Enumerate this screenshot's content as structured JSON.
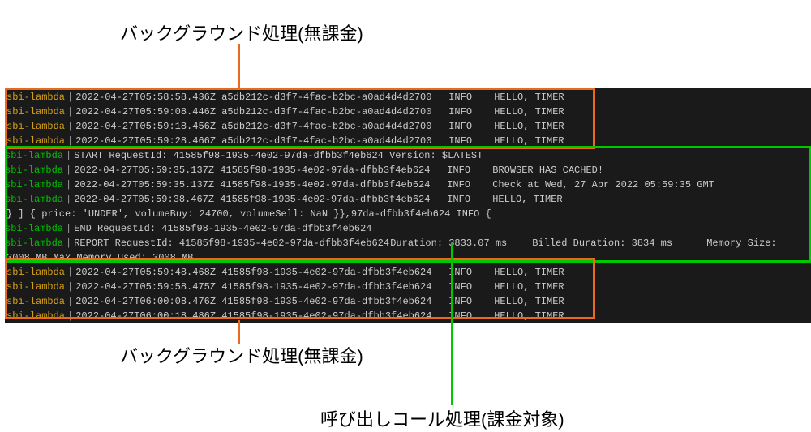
{
  "annotations": {
    "top": "バックグラウンド処理(無課金)",
    "bottom": "バックグラウンド処理(無課金)",
    "green": "呼び出しコール処理(課金対象)"
  },
  "source_label": "sbi-lambda",
  "pipe": "|",
  "bg_lines_top": [
    {
      "ts": "2022-04-27T05:58:58.436Z",
      "id": "a5db212c-d3f7-4fac-b2bc-a0ad4d4d2700",
      "level": "INFO",
      "msg": "HELLO, TIMER"
    },
    {
      "ts": "2022-04-27T05:59:08.446Z",
      "id": "a5db212c-d3f7-4fac-b2bc-a0ad4d4d2700",
      "level": "INFO",
      "msg": "HELLO, TIMER"
    },
    {
      "ts": "2022-04-27T05:59:18.456Z",
      "id": "a5db212c-d3f7-4fac-b2bc-a0ad4d4d2700",
      "level": "INFO",
      "msg": "HELLO, TIMER"
    },
    {
      "ts": "2022-04-27T05:59:28.466Z",
      "id": "a5db212c-d3f7-4fac-b2bc-a0ad4d4d2700",
      "level": "INFO",
      "msg": "HELLO, TIMER"
    }
  ],
  "billed_block": {
    "start": "START RequestId: 41585f98-1935-4e02-97da-dfbb3f4eb624 Version: $LATEST",
    "logs": [
      {
        "ts": "2022-04-27T05:59:35.137Z",
        "id": "41585f98-1935-4e02-97da-dfbb3f4eb624",
        "level": "INFO",
        "msg": "BROWSER HAS CACHED!"
      },
      {
        "ts": "2022-04-27T05:59:35.137Z",
        "id": "41585f98-1935-4e02-97da-dfbb3f4eb624",
        "level": "INFO",
        "msg": "Check at Wed, 27 Apr 2022 05:59:35 GMT"
      },
      {
        "ts": "2022-04-27T05:59:38.467Z",
        "id": "41585f98-1935-4e02-97da-dfbb3f4eb624",
        "level": "INFO",
        "msg": "HELLO, TIMER"
      }
    ],
    "payload_line": "} ] { price: 'UNDER', volumeBuy: 24700, volumeSell: NaN }},97da-dfbb3f4eb624    INFO    {",
    "end": "END RequestId: 41585f98-1935-4e02-97da-dfbb3f4eb624",
    "report_prefix": "REPORT RequestId: 41585f98-1935-4e02-97da-dfbb3f4eb624",
    "report_duration": "Duration: 3833.07 ms",
    "report_billed": "Billed Duration: 3834 ms",
    "report_memsize": "Memory Size:",
    "memline": "3008 MB    Max Memory Used: 3008 MB"
  },
  "bg_lines_bottom": [
    {
      "ts": "2022-04-27T05:59:48.468Z",
      "id": "41585f98-1935-4e02-97da-dfbb3f4eb624",
      "level": "INFO",
      "msg": "HELLO, TIMER"
    },
    {
      "ts": "2022-04-27T05:59:58.475Z",
      "id": "41585f98-1935-4e02-97da-dfbb3f4eb624",
      "level": "INFO",
      "msg": "HELLO, TIMER"
    },
    {
      "ts": "2022-04-27T06:00:08.476Z",
      "id": "41585f98-1935-4e02-97da-dfbb3f4eb624",
      "level": "INFO",
      "msg": "HELLO, TIMER"
    },
    {
      "ts": "2022-04-27T06:00:18.486Z",
      "id": "41585f98-1935-4e02-97da-dfbb3f4eb624",
      "level": "INFO",
      "msg": "HELLO, TIMER"
    }
  ]
}
